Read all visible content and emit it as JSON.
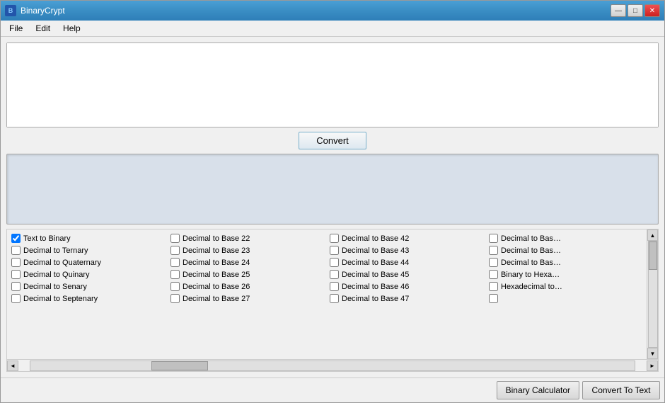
{
  "window": {
    "title": "BinaryCrypt",
    "icon": "BC"
  },
  "titlebar": {
    "controls": {
      "minimize": "—",
      "maximize": "□",
      "close": "✕"
    }
  },
  "menu": {
    "items": [
      "File",
      "Edit",
      "Help"
    ]
  },
  "convert_button": {
    "label": "Convert"
  },
  "bottom_buttons": {
    "binary_calc": "Binary Calculator",
    "convert_text": "Convert To Text"
  },
  "checkboxes": [
    {
      "label": "Text to Binary",
      "checked": true
    },
    {
      "label": "Decimal to Base 22",
      "checked": false
    },
    {
      "label": "Decimal to Base 42",
      "checked": false
    },
    {
      "label": "Decimal to Bas…",
      "checked": false
    },
    {
      "label": "Decimal to Ternary",
      "checked": false
    },
    {
      "label": "Decimal to Base 23",
      "checked": false
    },
    {
      "label": "Decimal to Base 43",
      "checked": false
    },
    {
      "label": "Decimal to Bas…",
      "checked": false
    },
    {
      "label": "Decimal to Quaternary",
      "checked": false
    },
    {
      "label": "Decimal to Base 24",
      "checked": false
    },
    {
      "label": "Decimal to Base 44",
      "checked": false
    },
    {
      "label": "Decimal to Bas…",
      "checked": false
    },
    {
      "label": "Decimal to Quinary",
      "checked": false
    },
    {
      "label": "Decimal to Base 25",
      "checked": false
    },
    {
      "label": "Decimal to Base 45",
      "checked": false
    },
    {
      "label": "Binary to Hexa…",
      "checked": false
    },
    {
      "label": "Decimal to Senary",
      "checked": false
    },
    {
      "label": "Decimal to Base 26",
      "checked": false
    },
    {
      "label": "Decimal to Base 46",
      "checked": false
    },
    {
      "label": "Hexadecimal to…",
      "checked": false
    },
    {
      "label": "Decimal to Septenary",
      "checked": false
    },
    {
      "label": "Decimal to Base 27",
      "checked": false
    },
    {
      "label": "Decimal to Base 47",
      "checked": false
    },
    {
      "label": "",
      "checked": false
    }
  ]
}
